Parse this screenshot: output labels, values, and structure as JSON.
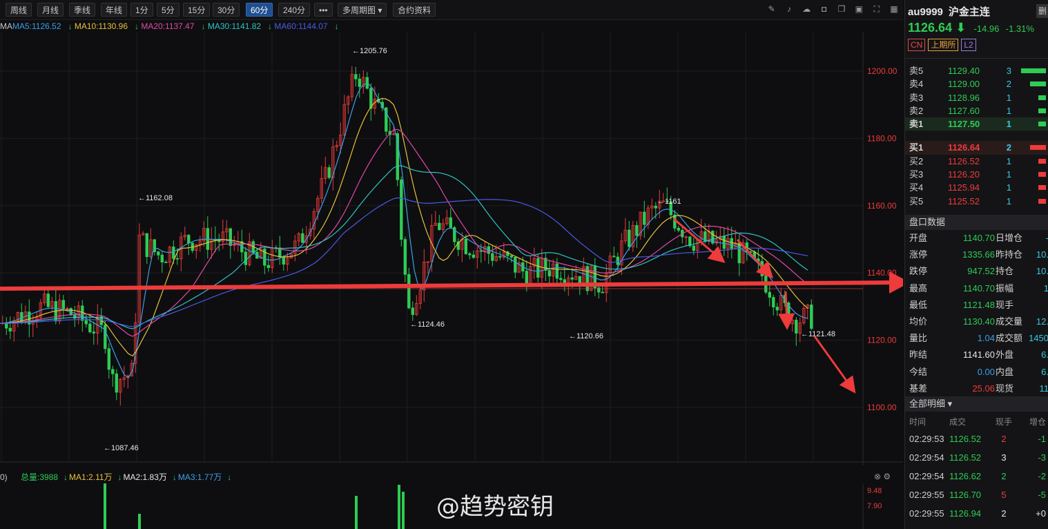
{
  "toolbar": {
    "buttons": [
      "周线",
      "月线",
      "季线",
      "年线",
      "1分",
      "5分",
      "15分",
      "30分",
      "60分",
      "240分",
      "•••",
      "多周期图 ▾",
      "合约资料"
    ],
    "active": "60分"
  },
  "ma_legend": {
    "prefix": "MA",
    "items": [
      {
        "text": "MA5:1126.52",
        "color": "#3aa0e8"
      },
      {
        "text": "MA10:1130.96",
        "color": "#e6c23a"
      },
      {
        "text": "MA20:1137.47",
        "color": "#e04aa8"
      },
      {
        "text": "MA30:1141.82",
        "color": "#2ec4c4"
      },
      {
        "text": "MA60:1144.07",
        "color": "#4a5ae8"
      }
    ]
  },
  "price_axis": [
    "1200.00",
    "1180.00",
    "1160.00",
    "1140.00",
    "1120.00",
    "1100.00"
  ],
  "annotations": [
    "←1205.76",
    "←1162.08",
    "←1124.46",
    "←1120.66",
    "←1161",
    "←1121.48",
    "←1087.46"
  ],
  "volume_legend": {
    "prefix": "0)",
    "items": [
      {
        "text": "总量:3988",
        "color": "#2ecc55"
      },
      {
        "text": "MA1:2.11万",
        "color": "#e6c23a"
      },
      {
        "text": "MA2:1.83万",
        "color": "#e8e8e8"
      },
      {
        "text": "MA3:1.77万",
        "color": "#3aa0e8"
      }
    ]
  },
  "volume_axis": [
    "9.48",
    "7.90"
  ],
  "watermark": "@趋势密钥",
  "panel": {
    "symbol": "au9999",
    "name": "沪金主连",
    "fav": "删",
    "price": "1126.64",
    "change": "-14.96",
    "change_pct": "-1.31%",
    "badges": [
      {
        "text": "CN",
        "color": "#e04a4a"
      },
      {
        "text": "上期所",
        "color": "#e6a23a"
      },
      {
        "text": "L2",
        "color": "#9a7ae0"
      }
    ],
    "sells": [
      {
        "label": "卖5",
        "price": "1129.40",
        "vol": "3",
        "bar": 0.95
      },
      {
        "label": "卖4",
        "price": "1129.00",
        "vol": "2",
        "bar": 0.6
      },
      {
        "label": "卖3",
        "price": "1128.96",
        "vol": "1",
        "bar": 0.3
      },
      {
        "label": "卖2",
        "price": "1127.60",
        "vol": "1",
        "bar": 0.3
      },
      {
        "label": "卖1",
        "price": "1127.50",
        "vol": "1",
        "bar": 0.3
      }
    ],
    "buys": [
      {
        "label": "买1",
        "price": "1126.64",
        "vol": "2",
        "bar": 0.6
      },
      {
        "label": "买2",
        "price": "1126.52",
        "vol": "1",
        "bar": 0.3
      },
      {
        "label": "买3",
        "price": "1126.20",
        "vol": "1",
        "bar": 0.3
      },
      {
        "label": "买4",
        "price": "1125.94",
        "vol": "1",
        "bar": 0.3
      },
      {
        "label": "买5",
        "price": "1125.52",
        "vol": "1",
        "bar": 0.3
      }
    ],
    "sell_color": "#2ecc55",
    "buy_color": "#ee3b3b",
    "section_quote": "盘口数据",
    "stats": [
      {
        "k1": "开盘",
        "v1": "1140.70",
        "c1": "#2ecc55",
        "k2": "日增仓",
        "v2": "-"
      },
      {
        "k1": "涨停",
        "v1": "1335.66",
        "c1": "#2ecc55",
        "k2": "昨持仓",
        "v2": "10."
      },
      {
        "k1": "跌停",
        "v1": "947.52",
        "c1": "#2ecc55",
        "k2": "持仓",
        "v2": "10."
      },
      {
        "k1": "最高",
        "v1": "1140.70",
        "c1": "#2ecc55",
        "k2": "振幅",
        "v2": "1"
      },
      {
        "k1": "最低",
        "v1": "1121.48",
        "c1": "#2ecc55",
        "k2": "现手",
        "v2": ""
      },
      {
        "k1": "均价",
        "v1": "1130.40",
        "c1": "#2ecc55",
        "k2": "成交量",
        "v2": "12."
      },
      {
        "k1": "量比",
        "v1": "1.04",
        "c1": "#3aa0e8",
        "k2": "成交额",
        "v2": "1450"
      },
      {
        "k1": "昨结",
        "v1": "1141.60",
        "c1": "#e8e8e8",
        "k2": "外盘",
        "v2": "6."
      },
      {
        "k1": "今结",
        "v1": "0.00",
        "c1": "#3aa0e8",
        "k2": "内盘",
        "v2": "6."
      },
      {
        "k1": "基差",
        "v1": "25.06",
        "c1": "#ee3b3b",
        "k2": "现货",
        "v2": "11"
      }
    ],
    "section_ticks": "全部明细 ▾",
    "tick_headers": [
      "时间",
      "成交",
      "现手",
      "增仓"
    ],
    "ticks": [
      {
        "t": "02:29:53",
        "p": "1126.52",
        "v": "2",
        "vc": "#ee3b3b",
        "d": "-1",
        "dc": "#2ecc55"
      },
      {
        "t": "02:29:54",
        "p": "1126.52",
        "v": "3",
        "vc": "#e8e8e8",
        "d": "-3",
        "dc": "#2ecc55"
      },
      {
        "t": "02:29:54",
        "p": "1126.62",
        "v": "2",
        "vc": "#2ecc55",
        "d": "-2",
        "dc": "#2ecc55"
      },
      {
        "t": "02:29:55",
        "p": "1126.70",
        "v": "5",
        "vc": "#ee3b3b",
        "d": "-5",
        "dc": "#2ecc55"
      },
      {
        "t": "02:29:55",
        "p": "1126.94",
        "v": "2",
        "vc": "#e8e8e8",
        "d": "+0",
        "dc": "#e8e8e8"
      }
    ]
  }
}
